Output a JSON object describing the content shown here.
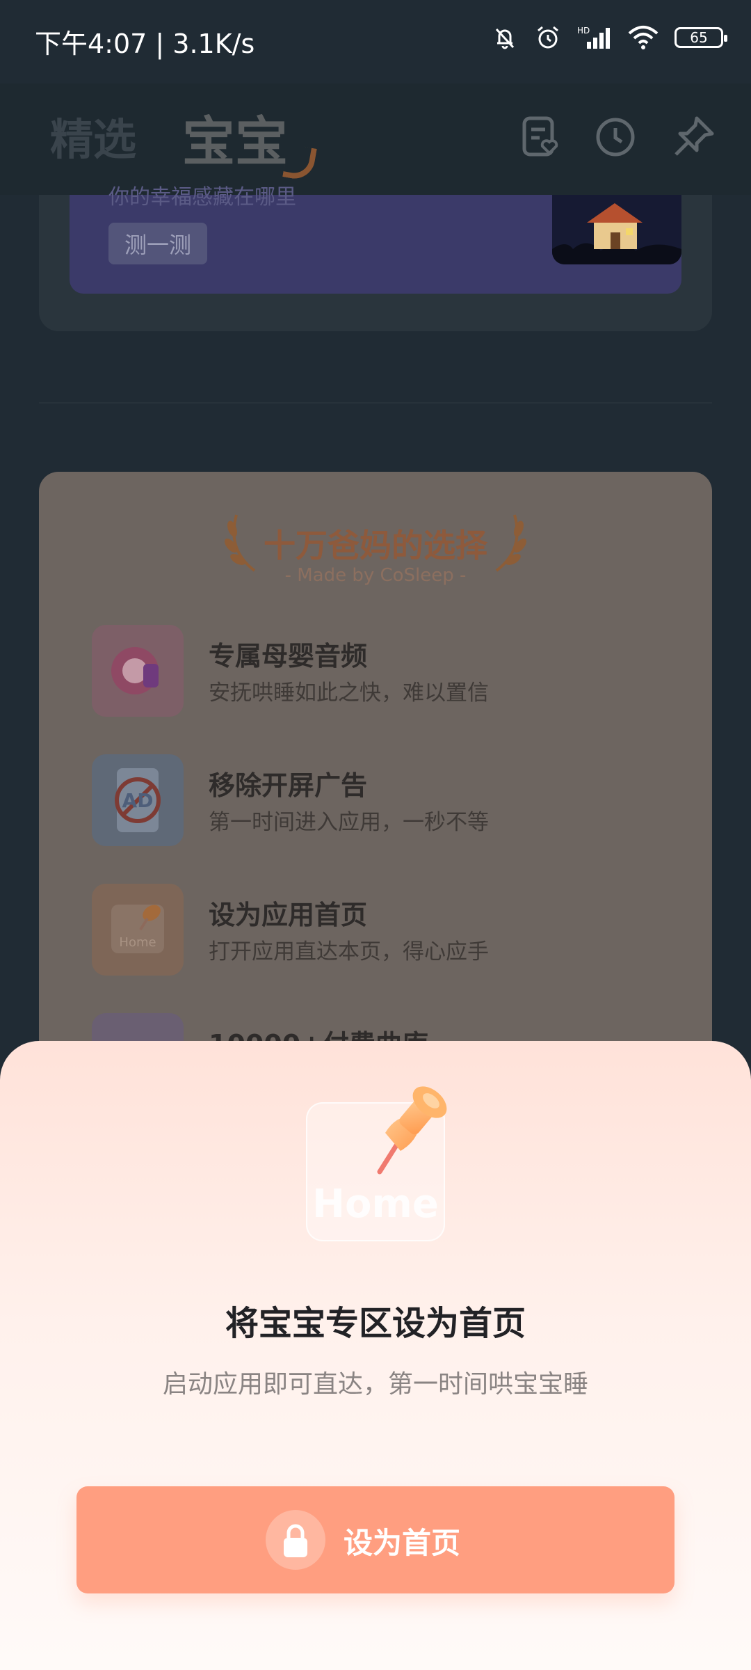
{
  "status_bar": {
    "time_speed": "下午4:07 | 3.1K/s",
    "battery": "65"
  },
  "header": {
    "tabs": [
      "精选",
      "宝宝"
    ]
  },
  "quiz_card": {
    "subtitle": "你的幸福感藏在哪里",
    "button": "测一测"
  },
  "vip_card": {
    "title": "十万爸妈的选择",
    "subtitle": "- Made by CoSleep -",
    "features": [
      {
        "name": "专属母婴音频",
        "desc": "安抚哄睡如此之快，难以置信"
      },
      {
        "name": "移除开屏广告",
        "desc": "第一时间进入应用，一秒不等"
      },
      {
        "name": "设为应用首页",
        "desc": "打开应用直达本页，得心应手"
      },
      {
        "name": "10000+付费曲库",
        "desc": ""
      }
    ],
    "icon_labels": {
      "ad": "AD",
      "home": "Home"
    }
  },
  "sheet": {
    "tile_label": "Home",
    "title": "将宝宝专区设为首页",
    "subtitle": "启动应用即可直达，第一时间哄宝宝睡",
    "button": "设为首页"
  },
  "colors": {
    "accent": "#ff9e80",
    "sheet_top": "#ffe2d9",
    "title": "#222226"
  }
}
